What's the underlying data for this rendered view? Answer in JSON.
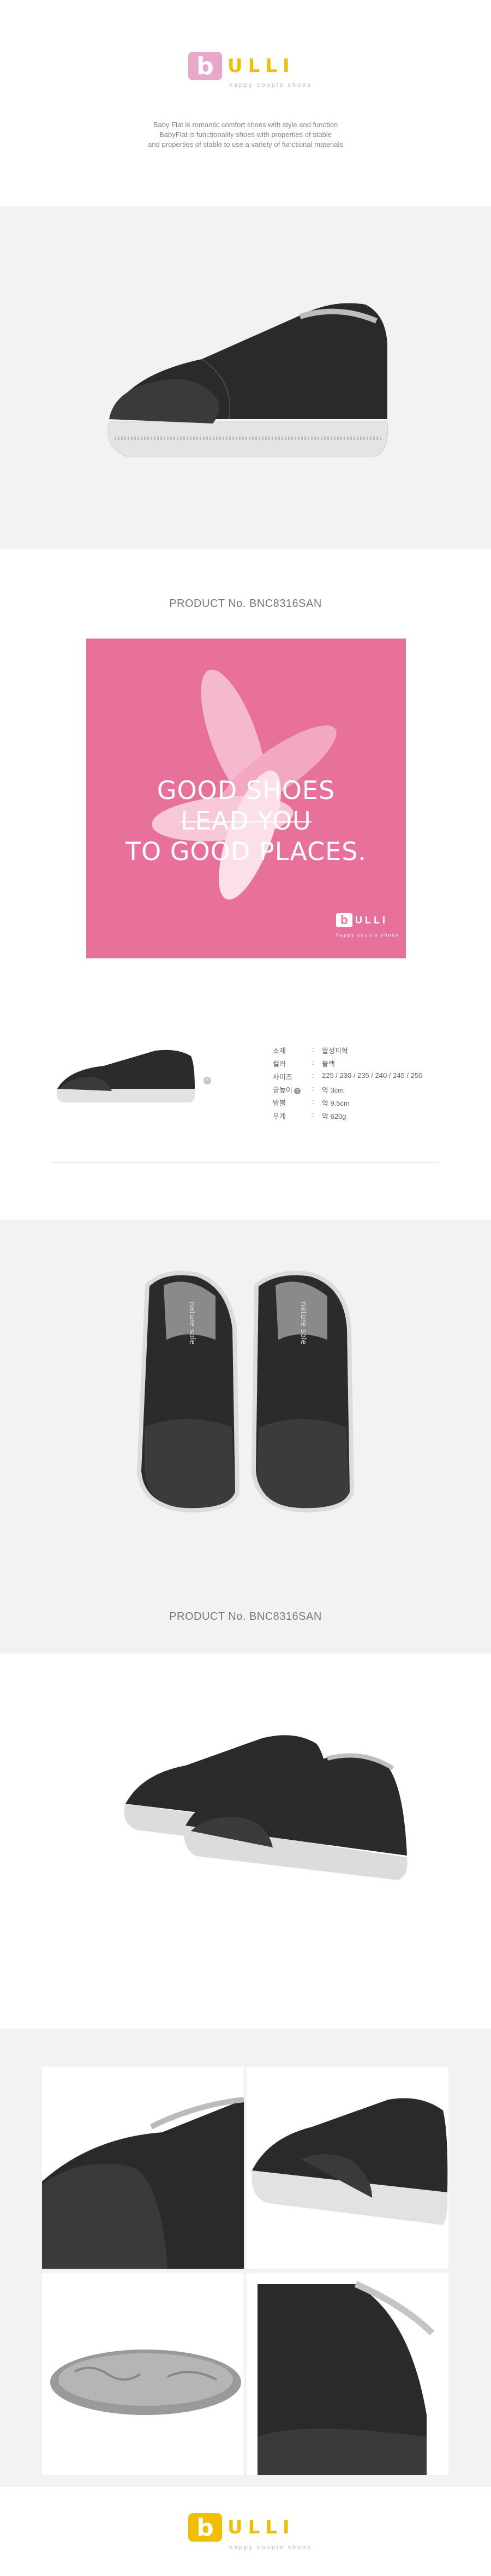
{
  "brand": {
    "logo_letter": "b",
    "logo_text": "ULLI",
    "tagline": "happy couple shoes",
    "colors": {
      "pink": "#e8719c",
      "logo_pink": "#e8a8c9",
      "logo_yellow": "#f0c000"
    }
  },
  "intro": {
    "line1": "Baby Flat is romantic comfort shoes with style and function",
    "line2": "BabyFlat is functionality shoes with properties of stable",
    "line3": "and properties of stable to use a variety of functional materials"
  },
  "product": {
    "number_label": "PRODUCT No. BNC8316SAN"
  },
  "banner": {
    "line1": "GOOD SHOES",
    "line2": "LEAD YOU",
    "line3": "TO GOOD PLACES.",
    "logo_letter": "b",
    "logo_text": "ULLI",
    "tagline": "happy couple shoes"
  },
  "specs": [
    {
      "label": "소재",
      "value": "합성피혁"
    },
    {
      "label": "컬러",
      "value": "블랙"
    },
    {
      "label": "사이즈",
      "value": "225 / 230 / 235 / 240 / 245 / 250"
    },
    {
      "label": "굽높이",
      "value": "약 3cm"
    },
    {
      "label": "발볼",
      "value": "약 9.5cm"
    },
    {
      "label": "무게",
      "value": "약 620g"
    }
  ],
  "shoe_text": {
    "insole": "nature sole"
  },
  "icons": [
    "zoom-icon",
    "info-icon"
  ]
}
